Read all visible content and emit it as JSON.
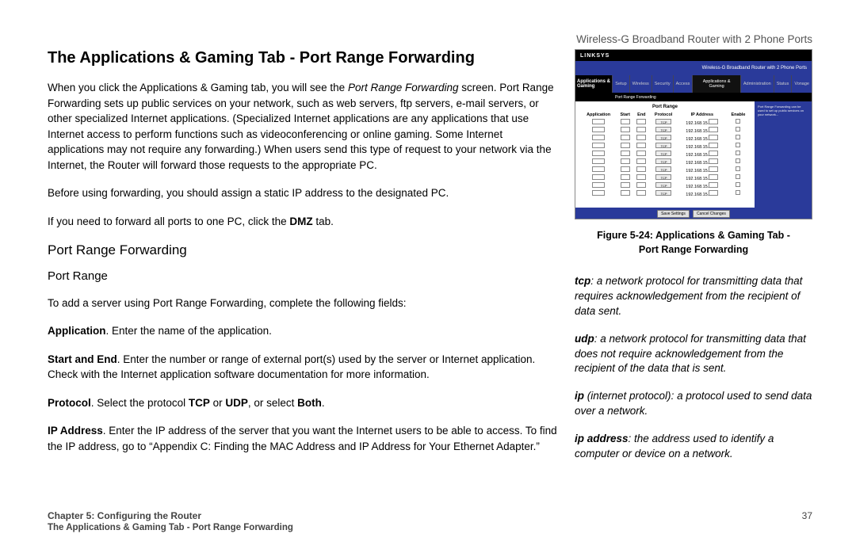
{
  "header_right": "Wireless-G Broadband Router with 2 Phone Ports",
  "title": "The Applications & Gaming Tab - Port Range Forwarding",
  "p1_a": "When you click the Applications & Gaming tab, you will see the ",
  "p1_b": "Port Range Forwarding",
  "p1_c": " screen. Port Range Forwarding sets up public services on your network, such as web servers, ftp servers, e-mail servers, or other specialized Internet applications. (Specialized Internet applications are any applications that use Internet access to perform functions such as videoconferencing or online gaming. Some Internet applications may not require any forwarding.) When users send this type of request to your network via the Internet, the Router will forward those requests to the appropriate PC.",
  "p2": "Before using forwarding, you should assign a static IP address to the designated PC.",
  "p3_a": "If you need to forward all ports to one PC, click the ",
  "p3_b": "DMZ",
  "p3_c": " tab.",
  "h2": "Port Range Forwarding",
  "h3": "Port Range",
  "p4": "To add a server using Port Range Forwarding, complete the following fields:",
  "f_app_label": "Application",
  "f_app_text": ". Enter the name of the application.",
  "f_se_label": "Start and End",
  "f_se_text": ". Enter the number or range of external port(s) used by the server or Internet application. Check with the Internet application software documentation for more information.",
  "f_proto_label": "Protocol",
  "f_proto_a": ". Select the protocol ",
  "f_proto_b": "TCP",
  "f_proto_c": " or ",
  "f_proto_d": "UDP",
  "f_proto_e": ", or select ",
  "f_proto_f": "Both",
  "f_proto_g": ".",
  "f_ip_label": "IP Address",
  "f_ip_text": ". Enter the IP address of the server that you want the Internet users to be able to access. To find the IP address, go to “Appendix C: Finding the MAC Address and IP Address for Your Ethernet Adapter.”",
  "fig": {
    "logo": "LINKSYS",
    "bluebar": "Wireless-G Broadband Router with 2 Phone Ports",
    "nav_active": "Applications & Gaming",
    "nav_items": [
      "Setup",
      "Wireless",
      "Security",
      "Access",
      "Applications & Gaming",
      "Administration",
      "Status",
      "Vonage"
    ],
    "subnav": "Port Range Forwarding",
    "table_title": "Port Range",
    "cols": [
      "Application",
      "Start",
      "End",
      "Protocol",
      "IP Address",
      "Enable"
    ],
    "proto": "TCP",
    "ip_prefix": "192.168.15.",
    "btn_save": "Save Settings",
    "btn_cancel": "Cancel Changes"
  },
  "fig_caption_a": "Figure 5-24: Applications & Gaming Tab - ",
  "fig_caption_b": "Port Range Forwarding",
  "defs": {
    "tcp_term": "tcp",
    "tcp_text": ": a network protocol for transmitting data that requires acknowledgement from the recipient of data sent.",
    "udp_term": "udp",
    "udp_text": ": a network protocol for transmitting data that does not require acknowledgement from the recipient of the data that is sent.",
    "ip_term": "ip",
    "ip_paren": " (internet protocol)",
    "ip_text": ": a protocol used to send data over a network.",
    "ipa_term": "ip address",
    "ipa_text": ": the address used to identify a computer or device on a network."
  },
  "footer": {
    "chapter": "Chapter 5: Configuring the Router",
    "page": "37",
    "sub": "The Applications & Gaming Tab - Port Range Forwarding"
  }
}
